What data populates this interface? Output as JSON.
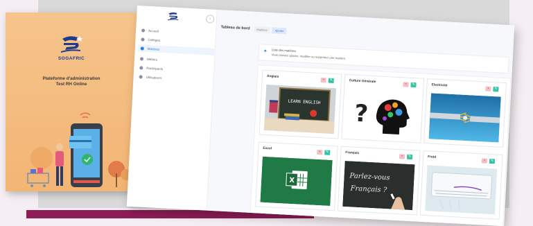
{
  "brochure": {
    "logo_text": "SOGAFRIC",
    "title_line1": "Plateforme d'administration",
    "title_line2": "Test RH Online"
  },
  "sidebar": {
    "items": [
      {
        "label": "Accueil",
        "active": false
      },
      {
        "label": "Collèges",
        "active": false
      },
      {
        "label": "Matières",
        "active": true
      },
      {
        "label": "Métiers",
        "active": false
      },
      {
        "label": "Participants",
        "active": false
      },
      {
        "label": "Utilisateurs",
        "active": false
      }
    ]
  },
  "header": {
    "title": "Tableau de bord",
    "crumbs": [
      "Matières",
      "Ajouter"
    ]
  },
  "info": {
    "line1": "Liste des matières",
    "line2": "Vous pouvez ajouter, modifier ou supprimer une matière."
  },
  "cards": [
    {
      "title": "Anglais",
      "image": "learn-english-chalkboard"
    },
    {
      "title": "Culture Générale",
      "image": "head-gears-question-mark"
    },
    {
      "title": "Electricité",
      "image": "electric-cable"
    },
    {
      "title": "Excel",
      "image": "excel-logo"
    },
    {
      "title": "Français",
      "image": "parlez-vous-francais-chalkboard"
    },
    {
      "title": "Froid",
      "image": "air-conditioner"
    }
  ],
  "card_image_texts": {
    "anglais": "LEARN ENGLISH",
    "francais_1": "Parlez-vous",
    "francais_2": "Français ?"
  },
  "icons": {
    "delete": "trash-icon",
    "edit": "pencil-icon"
  },
  "colors": {
    "accent": "#2f7be6",
    "edit": "#36c3a6",
    "delete": "#d9424f",
    "brochure": "#f3b574",
    "footer_bar": "#8d1d57"
  }
}
